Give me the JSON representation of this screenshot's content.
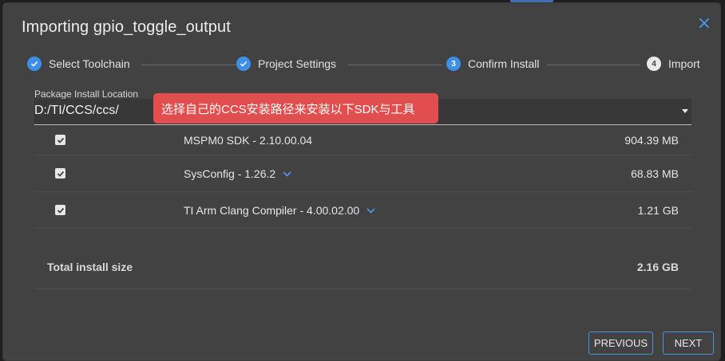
{
  "dialog": {
    "title": "Importing gpio_toggle_output",
    "close_icon": "close-icon"
  },
  "stepper": {
    "steps": [
      {
        "label": "Select Toolchain",
        "state": "done"
      },
      {
        "label": "Project Settings",
        "state": "done"
      },
      {
        "label": "Confirm Install",
        "state": "active",
        "number": "3"
      },
      {
        "label": "Import",
        "state": "pending",
        "number": "4"
      }
    ]
  },
  "install_location": {
    "label": "Package Install Location",
    "value": "D:/TI/CCS/ccs/"
  },
  "annotation": {
    "text": "选择自己的CCS安装路径来安装以下SDK与工具",
    "color": "#e24d4d"
  },
  "packages": [
    {
      "name": "MSPM0 SDK - 2.10.00.04",
      "size": "904.39 MB",
      "checked": true,
      "expandable": false
    },
    {
      "name": "SysConfig - 1.26.2",
      "size": "68.83 MB",
      "checked": true,
      "expandable": true
    },
    {
      "name": "TI Arm Clang Compiler - 4.00.02.00",
      "size": "1.21 GB",
      "checked": true,
      "expandable": true
    }
  ],
  "total": {
    "label": "Total install size",
    "value": "2.16 GB"
  },
  "buttons": {
    "previous": "PREVIOUS",
    "next": "NEXT"
  },
  "colors": {
    "accent": "#3d8ee8",
    "dialog_bg": "#424242"
  }
}
